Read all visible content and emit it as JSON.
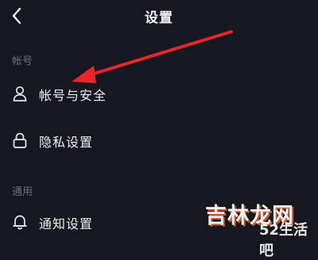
{
  "header": {
    "title": "设置",
    "back_icon": "chevron-left-icon"
  },
  "sections": [
    {
      "label": "帐号",
      "items": [
        {
          "label": "帐号与安全",
          "icon": "person-icon"
        },
        {
          "label": "隐私设置",
          "icon": "lock-icon"
        }
      ]
    },
    {
      "label": "通用",
      "items": [
        {
          "label": "通知设置",
          "icon": "bell-icon"
        }
      ]
    }
  ],
  "annotation": {
    "type": "arrow",
    "color": "#e8262b",
    "points_to": "帐号与安全"
  },
  "watermark": {
    "main": "吉林龙网",
    "sub": "52生活吧"
  },
  "colors": {
    "background": "#16181f",
    "text": "#ececef",
    "section_label": "#6f7079"
  }
}
